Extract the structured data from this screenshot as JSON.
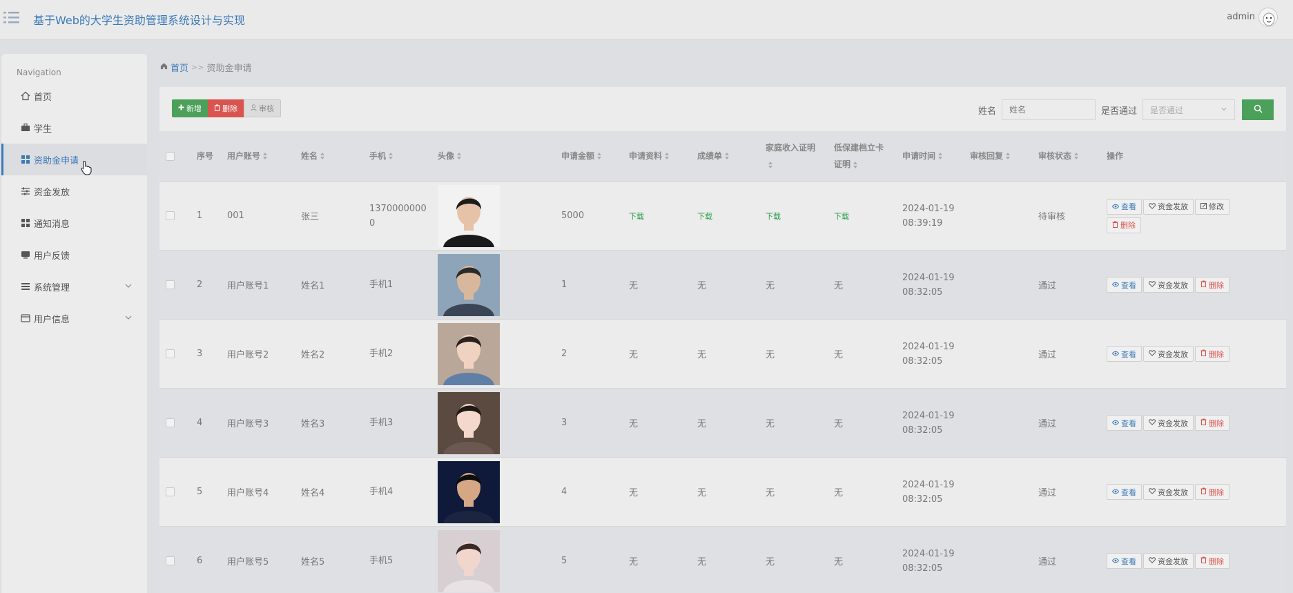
{
  "header": {
    "title": "基于Web的大学生资助管理系统设计与实现",
    "user": "admin"
  },
  "sidebar": {
    "heading": "Navigation",
    "items": [
      {
        "label": "首页"
      },
      {
        "label": "学生"
      },
      {
        "label": "资助金申请"
      },
      {
        "label": "资金发放"
      },
      {
        "label": "通知消息"
      },
      {
        "label": "用户反馈"
      },
      {
        "label": "系统管理"
      },
      {
        "label": "用户信息"
      }
    ]
  },
  "breadcrumb": {
    "home": "首页",
    "sep": ">>",
    "current": "资助金申请"
  },
  "toolbar": {
    "add": "新增",
    "delete": "删除",
    "audit": "审核"
  },
  "search": {
    "name_label": "姓名",
    "name_placeholder": "姓名",
    "pass_label": "是否通过",
    "pass_placeholder": "是否通过"
  },
  "table": {
    "headers": {
      "index": "序号",
      "account": "用户账号",
      "name": "姓名",
      "phone": "手机",
      "avatar": "头像",
      "amount": "申请金额",
      "material": "申请资料",
      "transcript": "成绩单",
      "income_1": "家庭收入证明",
      "income_2": "",
      "card_1": "低保建档立卡",
      "card_2": "证明",
      "time": "申请时间",
      "reply": "审核回复",
      "status": "审核状态",
      "ops": "操作"
    },
    "rows": [
      {
        "index": "1",
        "account": "001",
        "name": "张三",
        "phone": "13700000000",
        "amount": "5000",
        "material": "下载",
        "transcript": "下载",
        "income": "下载",
        "card": "下载",
        "date": "2024-01-19",
        "time": "08:39:19",
        "reply": "",
        "status": "待审核",
        "ops": [
          "查看",
          "资金发放",
          "修改",
          "删除"
        ]
      },
      {
        "index": "2",
        "account": "用户账号1",
        "name": "姓名1",
        "phone": "手机1",
        "amount": "1",
        "material": "无",
        "transcript": "无",
        "income": "无",
        "card": "无",
        "date": "2024-01-19",
        "time": "08:32:05",
        "reply": "",
        "status": "通过",
        "ops": [
          "查看",
          "资金发放",
          "删除"
        ]
      },
      {
        "index": "3",
        "account": "用户账号2",
        "name": "姓名2",
        "phone": "手机2",
        "amount": "2",
        "material": "无",
        "transcript": "无",
        "income": "无",
        "card": "无",
        "date": "2024-01-19",
        "time": "08:32:05",
        "reply": "",
        "status": "通过",
        "ops": [
          "查看",
          "资金发放",
          "删除"
        ]
      },
      {
        "index": "4",
        "account": "用户账号3",
        "name": "姓名3",
        "phone": "手机3",
        "amount": "3",
        "material": "无",
        "transcript": "无",
        "income": "无",
        "card": "无",
        "date": "2024-01-19",
        "time": "08:32:05",
        "reply": "",
        "status": "通过",
        "ops": [
          "查看",
          "资金发放",
          "删除"
        ]
      },
      {
        "index": "5",
        "account": "用户账号4",
        "name": "姓名4",
        "phone": "手机4",
        "amount": "4",
        "material": "无",
        "transcript": "无",
        "income": "无",
        "card": "无",
        "date": "2024-01-19",
        "time": "08:32:05",
        "reply": "",
        "status": "通过",
        "ops": [
          "查看",
          "资金发放",
          "删除"
        ]
      },
      {
        "index": "6",
        "account": "用户账号5",
        "name": "姓名5",
        "phone": "手机5",
        "amount": "5",
        "material": "无",
        "transcript": "无",
        "income": "无",
        "card": "无",
        "date": "2024-01-19",
        "time": "08:32:05",
        "reply": "",
        "status": "通过",
        "ops": [
          "查看",
          "资金发放",
          "删除"
        ]
      }
    ]
  },
  "colors": {
    "brand": "#3b79b8",
    "add": "#4ba05a",
    "danger": "#d9534f",
    "download": "#2a9d4a"
  }
}
